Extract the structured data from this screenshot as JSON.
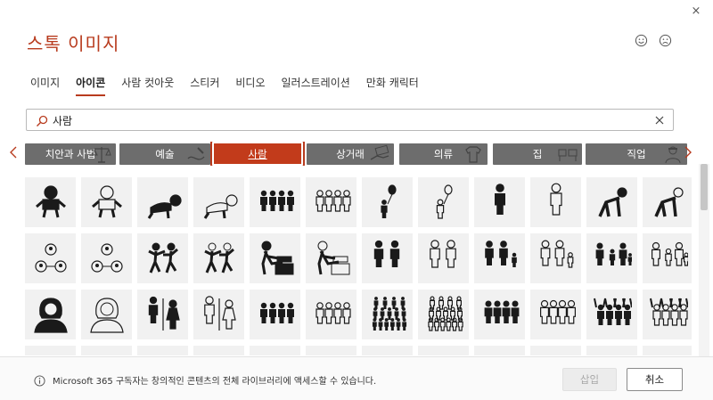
{
  "dialog": {
    "title": "스톡 이미지",
    "close_glyph": "×",
    "feedback": [
      "smile-face-icon",
      "frown-face-icon"
    ]
  },
  "tabs": [
    {
      "label": "이미지",
      "active": false
    },
    {
      "label": "아이콘",
      "active": true
    },
    {
      "label": "사람 컷아웃",
      "active": false
    },
    {
      "label": "스티커",
      "active": false
    },
    {
      "label": "비디오",
      "active": false
    },
    {
      "label": "일러스트레이션",
      "active": false
    },
    {
      "label": "만화 캐릭터",
      "active": false
    }
  ],
  "search": {
    "value": "사람",
    "icon": "search-icon",
    "clear_icon": "clear-icon"
  },
  "categories": [
    {
      "label": "치안과 사법",
      "selected": false,
      "icon": "scales-icon"
    },
    {
      "label": "예술",
      "selected": false,
      "icon": "brush-icon"
    },
    {
      "label": "사람",
      "selected": true,
      "icon": ""
    },
    {
      "label": "상거래",
      "selected": false,
      "icon": "money-hand-icon"
    },
    {
      "label": "의류",
      "selected": false,
      "icon": "shirt-icon"
    },
    {
      "label": "집",
      "selected": false,
      "icon": "furniture-icon"
    },
    {
      "label": "직업",
      "selected": false,
      "icon": "worker-icon"
    }
  ],
  "icons": [
    [
      "baby",
      "baby",
      "crawling-baby",
      "crawling-baby",
      "group-of-people",
      "group-of-people",
      "child-with-balloon",
      "child-with-balloon",
      "person-standing",
      "person-standing",
      "crawling-person",
      "crawling-person"
    ],
    [
      "people-network",
      "people-network",
      "dancing-people",
      "dancing-people",
      "diaper-change",
      "diaper-change",
      "family",
      "family",
      "family-with-child",
      "family-with-child",
      "family-of-four",
      "family-of-four"
    ],
    [
      "woman-avatar",
      "woman-avatar",
      "restroom-sign",
      "restroom-sign",
      "group-of-people",
      "group-of-people",
      "crowd",
      "crowd",
      "women-group",
      "women-group",
      "cheering-people",
      "cheering-people"
    ]
  ],
  "colors": {
    "accent": "#b83b1e",
    "category_bg": "#6d6d6d",
    "category_selected": "#c23b1b",
    "tile_bg": "#f1f1f1",
    "icon_fill": "#1a1a1a"
  },
  "footer": {
    "info_icon": "info-icon",
    "message": "Microsoft 365 구독자는 창의적인 콘텐츠의 전체 라이브러리에 액세스할 수 있습니다.",
    "insert_label": "삽입",
    "cancel_label": "취소"
  }
}
